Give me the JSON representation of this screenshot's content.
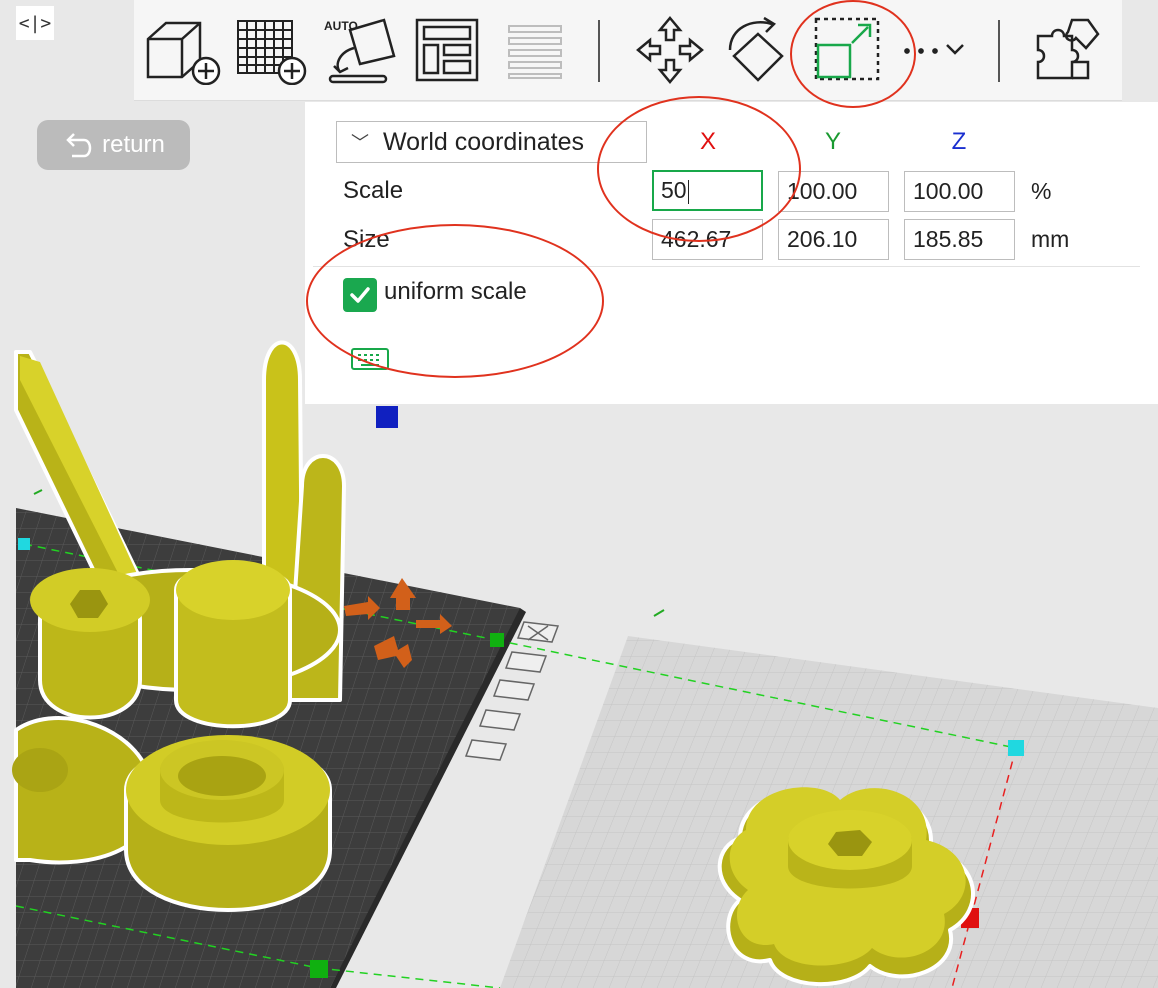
{
  "app": {
    "return_label": "return",
    "collapse_glyph": "<|>"
  },
  "toolbar": {
    "items": [
      {
        "name": "add-object",
        "icon": "cube-plus-icon"
      },
      {
        "name": "add-plate",
        "icon": "grid-plus-icon"
      },
      {
        "name": "auto-orient",
        "icon": "auto-orient-icon",
        "label": "AUTO"
      },
      {
        "name": "arrange",
        "icon": "arrange-icon"
      },
      {
        "name": "split-layers",
        "icon": "layers-icon"
      },
      {
        "name": "move",
        "icon": "move-arrows-icon"
      },
      {
        "name": "rotate",
        "icon": "rotate-icon"
      },
      {
        "name": "scale",
        "icon": "scale-icon",
        "active": true
      },
      {
        "name": "more",
        "icon": "more-dots-icon",
        "label": "···"
      },
      {
        "name": "assembly",
        "icon": "puzzle-icon"
      }
    ]
  },
  "scale_panel": {
    "coordinate_system": "World coordinates",
    "axes": {
      "x": "X",
      "y": "Y",
      "z": "Z"
    },
    "axis_colors": {
      "x": "#e01010",
      "y": "#1a9a30",
      "z": "#1a2fd0"
    },
    "scale": {
      "label": "Scale",
      "x": "50",
      "y": "100.00",
      "z": "100.00",
      "unit": "%"
    },
    "size": {
      "label": "Size",
      "x": "462.67",
      "y": "206.10",
      "z": "185.85",
      "unit": "mm"
    },
    "uniform_scale": {
      "label": "uniform scale",
      "checked": true
    }
  },
  "colors": {
    "accent": "#18a84a",
    "model": "#c9c21a",
    "annotation": "#e0321e",
    "bed_dark": "#3a3a3a",
    "bed_light": "#d6d6d6"
  }
}
